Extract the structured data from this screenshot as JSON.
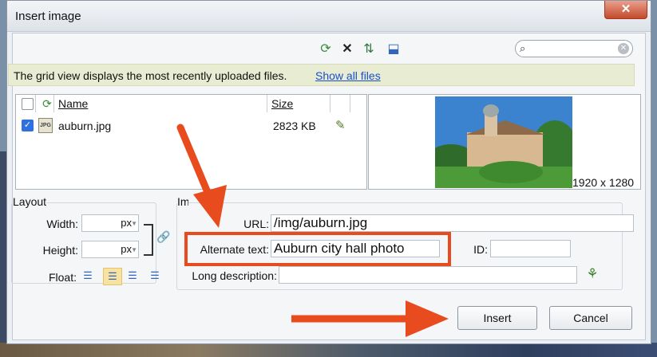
{
  "dialog": {
    "title": "Insert image",
    "close_icon": "close-icon"
  },
  "toolbar": {
    "icons": [
      "refresh-icon",
      "delete-icon",
      "sort-icon",
      "upload-icon"
    ]
  },
  "search": {
    "value": "",
    "placeholder": ""
  },
  "info_bar": {
    "text": "The grid view displays the most recently uploaded files.",
    "link": "Show all files"
  },
  "file_grid": {
    "columns": {
      "name": "Name",
      "size": "Size"
    },
    "rows": [
      {
        "name": "auburn.jpg",
        "size": "2823 KB",
        "checked": true,
        "icon": "JPG"
      }
    ]
  },
  "preview": {
    "dimensions": "1920 x 1280"
  },
  "layout": {
    "legend": "Layout",
    "width_label": "Width:",
    "height_label": "Height:",
    "width_unit": "px",
    "height_unit": "px",
    "float_label": "Float:",
    "selected_float_index": 1
  },
  "image_info": {
    "legend": "Image info",
    "url_label": "URL:",
    "url_value": "/img/auburn.jpg",
    "alt_label": "Alternate text:",
    "alt_value": "Auburn city hall photo",
    "id_label": "ID:",
    "id_value": "",
    "longdesc_label": "Long description:",
    "longdesc_value": ""
  },
  "buttons": {
    "insert": "Insert",
    "cancel": "Cancel"
  },
  "colors": {
    "annotation": "#e84b1d",
    "link": "#1a4fc9",
    "info_bar": "#e8ecd2"
  }
}
